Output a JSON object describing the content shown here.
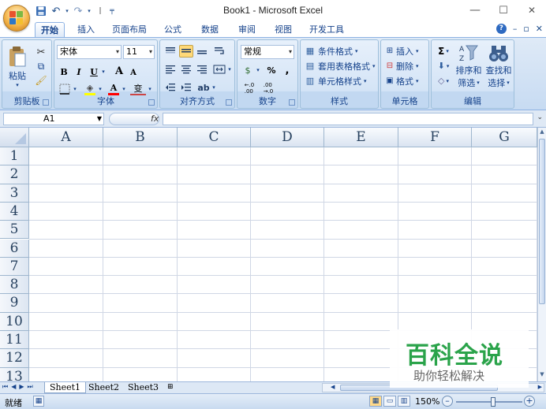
{
  "window": {
    "title": "Book1 - Microsoft Excel",
    "minimize": "—",
    "maximize": "☐",
    "close": "✕"
  },
  "qat": {
    "save_icon": "save-icon",
    "undo": "↶",
    "redo": "↷",
    "customize": "⌄"
  },
  "tabs": [
    {
      "label": "开始",
      "active": true
    },
    {
      "label": "插入"
    },
    {
      "label": "页面布局"
    },
    {
      "label": "公式"
    },
    {
      "label": "数据"
    },
    {
      "label": "审阅"
    },
    {
      "label": "视图"
    },
    {
      "label": "开发工具"
    }
  ],
  "help_controls": {
    "help": "?",
    "min": "–",
    "restore": "▫",
    "close": "✕"
  },
  "ribbon": {
    "clipboard": {
      "label": "剪贴板",
      "paste": "粘贴"
    },
    "font": {
      "label": "字体",
      "font_name": "宋体",
      "font_size": "11",
      "bold": "B",
      "italic": "I",
      "underline": "U",
      "grow": "A",
      "shrink": "A",
      "font_color": "A",
      "phonetic": "变"
    },
    "alignment": {
      "label": "对齐方式"
    },
    "number": {
      "label": "数字",
      "format": "常规",
      "percent": "%",
      "comma": ",",
      "inc_decimal": ".0 .00",
      "dec_decimal": ".00 .0"
    },
    "styles": {
      "label": "样式",
      "conditional": "条件格式",
      "table": "套用表格格式",
      "cell_styles": "单元格样式"
    },
    "cells": {
      "label": "单元格",
      "insert": "插入",
      "delete": "删除",
      "format": "格式"
    },
    "editing": {
      "label": "编辑",
      "sum": "Σ",
      "sort": "排序和\n筛选",
      "sort_line1": "排序和",
      "sort_line2": "筛选",
      "find_line1": "查找和",
      "find_line2": "选择"
    }
  },
  "formula_bar": {
    "name_box": "A1",
    "fx": "fx",
    "value": ""
  },
  "grid": {
    "columns": [
      "A",
      "B",
      "C",
      "D",
      "E",
      "F",
      "G"
    ],
    "rows": [
      "1",
      "2",
      "3",
      "4",
      "5",
      "6",
      "7",
      "8",
      "9",
      "10",
      "11",
      "12",
      "13"
    ]
  },
  "sheets": [
    {
      "label": "Sheet1",
      "active": true
    },
    {
      "label": "Sheet2"
    },
    {
      "label": "Sheet3"
    }
  ],
  "status": {
    "ready": "就绪",
    "zoom": "150%"
  },
  "watermark": {
    "line1": "百科全说",
    "line2": "助你轻松解决"
  },
  "colors": {
    "ribbon_bg": "#dbe7f6",
    "accent": "#15428b",
    "grid_line": "#d0d7e5",
    "watermark_green": "#2aa34a"
  }
}
